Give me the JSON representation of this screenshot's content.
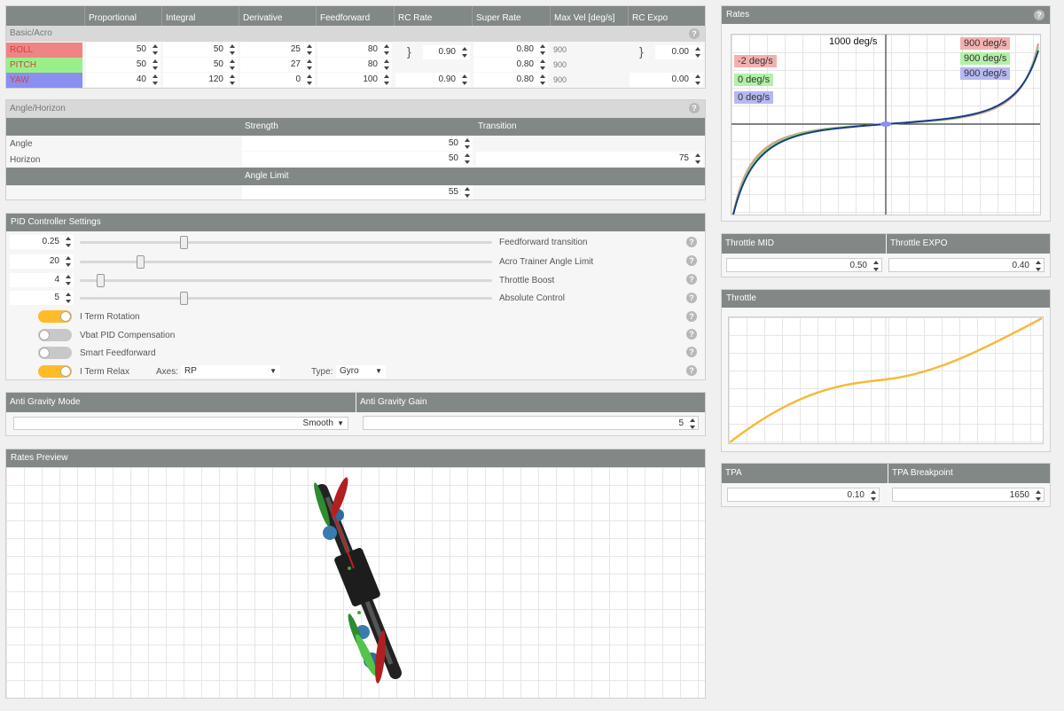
{
  "pid_table": {
    "section_label": "Basic/Acro",
    "columns": [
      "Proportional",
      "Integral",
      "Derivative",
      "Feedforward",
      "RC Rate",
      "Super Rate",
      "Max Vel [deg/s]",
      "RC Expo"
    ],
    "rows": [
      {
        "name": "ROLL",
        "color": "#ef8484",
        "p": "50",
        "i": "50",
        "d": "25",
        "ff": "80",
        "super": "0.80",
        "maxvel": "900"
      },
      {
        "name": "PITCH",
        "color": "#99f08a",
        "p": "50",
        "i": "50",
        "d": "27",
        "ff": "80",
        "super": "0.80",
        "maxvel": "900"
      },
      {
        "name": "YAW",
        "color": "#8a8ff0",
        "p": "40",
        "i": "120",
        "d": "0",
        "ff": "100",
        "super": "0.80",
        "maxvel": "900"
      }
    ],
    "rc_rate_rp": "0.90",
    "rc_rate_yaw": "0.90",
    "rc_expo_rp": "0.00",
    "rc_expo_yaw": "0.00"
  },
  "angle_horizon": {
    "title": "Angle/Horizon",
    "strength_label": "Strength",
    "transition_label": "Transition",
    "angle_label": "Angle",
    "horizon_label": "Horizon",
    "angle_strength": "50",
    "horizon_strength": "50",
    "horizon_transition": "75",
    "angle_limit_label": "Angle Limit",
    "angle_limit": "55"
  },
  "pid_settings": {
    "title": "PID Controller Settings",
    "sliders": [
      {
        "value": "0.25",
        "label": "Feedforward transition",
        "pos": 0.25
      },
      {
        "value": "20",
        "label": "Acro Trainer Angle Limit",
        "pos": 0.15
      },
      {
        "value": "4",
        "label": "Throttle Boost",
        "pos": 0.05
      },
      {
        "value": "5",
        "label": "Absolute Control",
        "pos": 0.25
      }
    ],
    "toggles": [
      {
        "label": "I Term Rotation",
        "on": true
      },
      {
        "label": "Vbat PID Compensation",
        "on": false
      },
      {
        "label": "Smart Feedforward",
        "on": false
      },
      {
        "label": "I Term Relax",
        "on": true
      }
    ],
    "axes_label": "Axes:",
    "axes_value": "RP",
    "type_label": "Type:",
    "type_value": "Gyro"
  },
  "anti_gravity": {
    "mode_label": "Anti Gravity Mode",
    "gain_label": "Anti Gravity Gain",
    "mode_value": "Smooth",
    "gain_value": "5"
  },
  "rates_preview": {
    "title": "Rates Preview"
  },
  "rates": {
    "title": "Rates",
    "top_label": "1000 deg/s",
    "badges_right": [
      "900 deg/s",
      "900 deg/s",
      "900 deg/s"
    ],
    "badges_left": [
      "-2 deg/s",
      "0 deg/s",
      "0 deg/s"
    ],
    "colors": {
      "roll": "#f4b0b0",
      "pitch": "#b3f0a8",
      "yaw": "#b6b8f2"
    }
  },
  "throttle_settings": {
    "mid_label": "Throttle MID",
    "expo_label": "Throttle EXPO",
    "mid_value": "0.50",
    "expo_value": "0.40"
  },
  "throttle_curve": {
    "title": "Throttle"
  },
  "tpa": {
    "tpa_label": "TPA",
    "breakpoint_label": "TPA Breakpoint",
    "tpa_value": "0.10",
    "breakpoint_value": "1650"
  }
}
